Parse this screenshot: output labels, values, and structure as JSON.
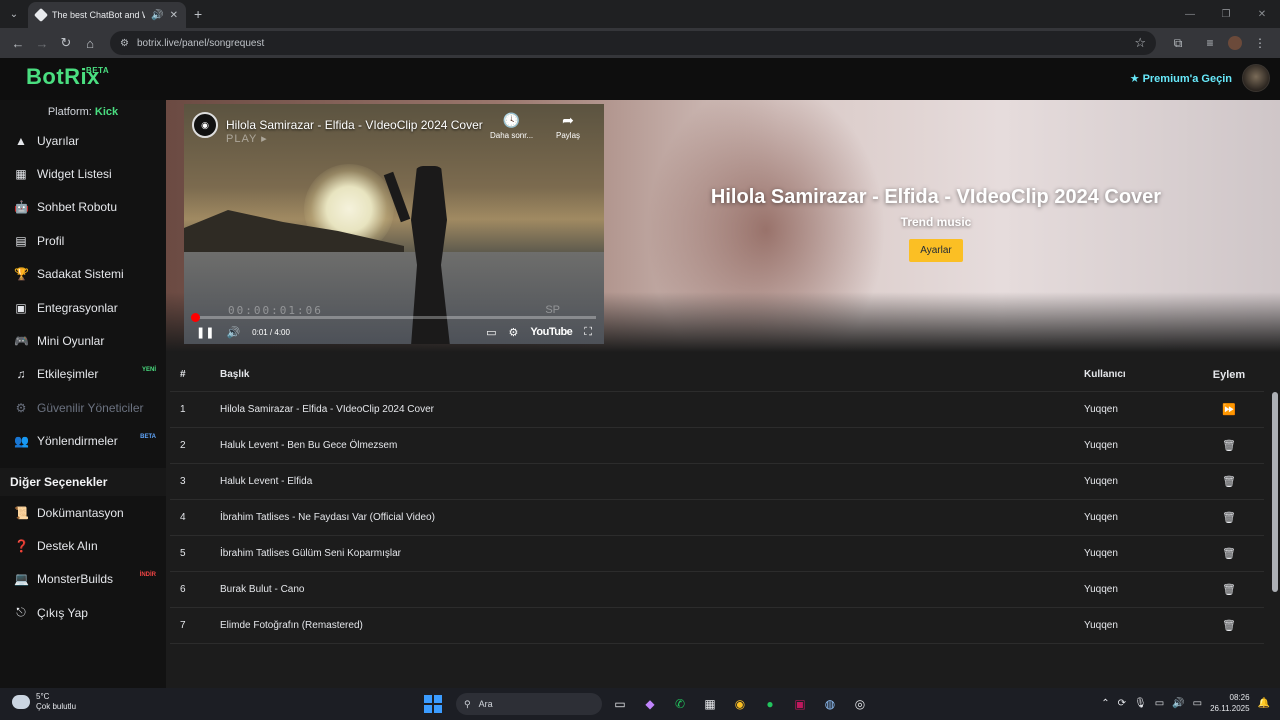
{
  "browser": {
    "tab_title": "The best ChatBot and Widg",
    "url": "botrix.live/panel/songrequest"
  },
  "header": {
    "logo": "BotRix",
    "logo_badge": "BETA",
    "premium_label": "Premium'a Geçin"
  },
  "sidebar": {
    "platform_label": "Platform:",
    "platform_value": "Kick",
    "items": [
      {
        "label": "Uyarılar",
        "icon": "warning-icon"
      },
      {
        "label": "Widget Listesi",
        "icon": "grid-icon"
      },
      {
        "label": "Sohbet Robotu",
        "icon": "robot-icon"
      },
      {
        "label": "Profil",
        "icon": "id-card-icon"
      },
      {
        "label": "Sadakat Sistemi",
        "icon": "trophy-icon"
      },
      {
        "label": "Entegrasyonlar",
        "icon": "plug-icon"
      },
      {
        "label": "Mini Oyunlar",
        "icon": "gamepad-icon"
      },
      {
        "label": "Etkileşimler",
        "icon": "music-icon",
        "badge": "YENİ"
      },
      {
        "label": "Güvenilir Yöneticiler",
        "icon": "users-cog-icon"
      },
      {
        "label": "Yönlendirmeler",
        "icon": "users-icon",
        "badge": "BETA"
      }
    ],
    "other_title": "Diğer Seçenekler",
    "other_items": [
      {
        "label": "Dokümantasyon",
        "icon": "scroll-icon"
      },
      {
        "label": "Destek Alın",
        "icon": "question-icon"
      },
      {
        "label": "MonsterBuilds",
        "icon": "laptop-icon",
        "badge": "İNDİR"
      },
      {
        "label": "Çıkış Yap",
        "icon": "logout-icon"
      }
    ]
  },
  "player": {
    "video_title": "Hilola Samirazar - Elfida - VIdeoClip 2024 Cover",
    "overlay_play": "PLAY ▸",
    "later_label": "Daha sonr...",
    "share_label": "Paylaş",
    "vhs_timecode": "00:00:01:06",
    "vhs_mode": "SP",
    "time": "0:01 / 4:00",
    "progress": 0.004,
    "youtube_label": "YouTube"
  },
  "now_playing": {
    "title": "Hilola Samirazar - Elfida - VIdeoClip 2024 Cover",
    "subtitle": "Trend music",
    "settings_label": "Ayarlar"
  },
  "queue": {
    "headers": {
      "num": "#",
      "title": "Başlık",
      "user": "Kullanıcı",
      "action": "Eylem"
    },
    "rows": [
      {
        "num": "1",
        "title": "Hilola Samirazar - Elfida - VIdeoClip 2024 Cover",
        "user": "Yuqqen",
        "action": "skip"
      },
      {
        "num": "2",
        "title": "Haluk Levent - Ben Bu Gece Ölmezsem",
        "user": "Yuqqen",
        "action": "delete"
      },
      {
        "num": "3",
        "title": "Haluk Levent - Elfida",
        "user": "Yuqqen",
        "action": "delete"
      },
      {
        "num": "4",
        "title": "İbrahim Tatlises - Ne Faydası Var (Official Video)",
        "user": "Yuqqen",
        "action": "delete"
      },
      {
        "num": "5",
        "title": "İbrahim Tatlises Gülüm Seni Koparmışlar",
        "user": "Yuqqen",
        "action": "delete"
      },
      {
        "num": "6",
        "title": "Burak Bulut - Cano",
        "user": "Yuqqen",
        "action": "delete"
      },
      {
        "num": "7",
        "title": "Elimde Fotoğrafın (Remastered)",
        "user": "Yuqqen",
        "action": "delete"
      }
    ]
  },
  "taskbar": {
    "temp": "5°C",
    "weather": "Çok bulutlu",
    "search_placeholder": "Ara",
    "time": "08:26",
    "date": "26.11.2025"
  }
}
